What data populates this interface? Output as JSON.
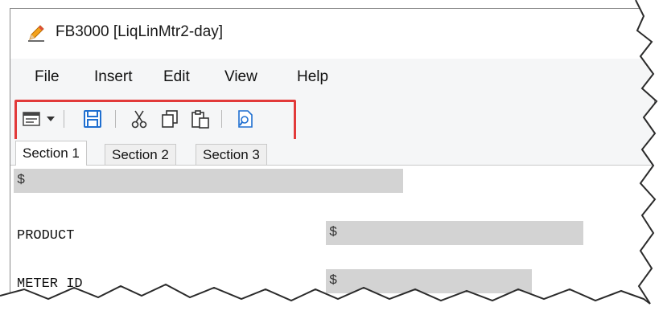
{
  "window": {
    "title": "FB3000 [LiqLinMtr2-day]"
  },
  "menubar": {
    "items": [
      "File",
      "Insert",
      "Edit",
      "View",
      "Help"
    ]
  },
  "toolbar": {
    "buttons": [
      "form-dropdown",
      "save",
      "cut",
      "copy",
      "paste",
      "preview"
    ],
    "highlight_color": "#e23a3a"
  },
  "tabs": [
    "Section 1",
    "Section 2",
    "Section 3"
  ],
  "active_tab": "Section 1",
  "form": {
    "top_field_value": "$",
    "product_label": "PRODUCT",
    "product_value": "$",
    "meter_label": "METER ID",
    "meter_value": "$"
  },
  "colors": {
    "field_bg": "#d3d3d3",
    "toolbar_bg": "#f5f6f7",
    "accent": "#1f6fd0"
  }
}
